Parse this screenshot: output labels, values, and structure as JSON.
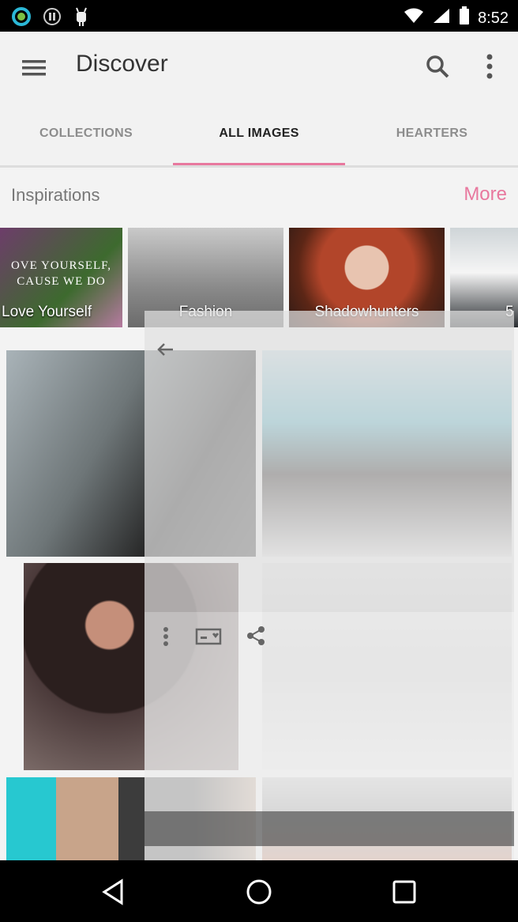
{
  "status_bar": {
    "time": "8:52",
    "icons": [
      "circle-app-icon",
      "pause-icon",
      "android-icon",
      "wifi-icon",
      "signal-icon",
      "battery-icon"
    ]
  },
  "app_bar": {
    "title": "Discover",
    "icons": [
      "menu-icon",
      "search-icon",
      "more-vert-icon"
    ]
  },
  "tabs": [
    {
      "label": "COLLECTIONS",
      "active": false
    },
    {
      "label": "ALL IMAGES",
      "active": true
    },
    {
      "label": "HEARTERS",
      "active": false
    }
  ],
  "inspirations": {
    "label": "Inspirations",
    "more_label": "More",
    "items": [
      {
        "caption": "Love Yourself",
        "image_text": "OVE YOURSELF,\nCAUSE WE DO"
      },
      {
        "caption": "Fashion"
      },
      {
        "caption": "Shadowhunters"
      },
      {
        "caption": "5"
      }
    ]
  },
  "overlay_icons": [
    "back-arrow-icon",
    "more-vert-icon",
    "newspaper-heart-icon",
    "share-icon"
  ],
  "nav_bar": {
    "icons": [
      "back-triangle-icon",
      "home-circle-icon",
      "recents-square-icon"
    ]
  },
  "colors": {
    "accent": "#e8789e",
    "status_bar": "#000000",
    "app_bar": "#f2f2f2"
  }
}
